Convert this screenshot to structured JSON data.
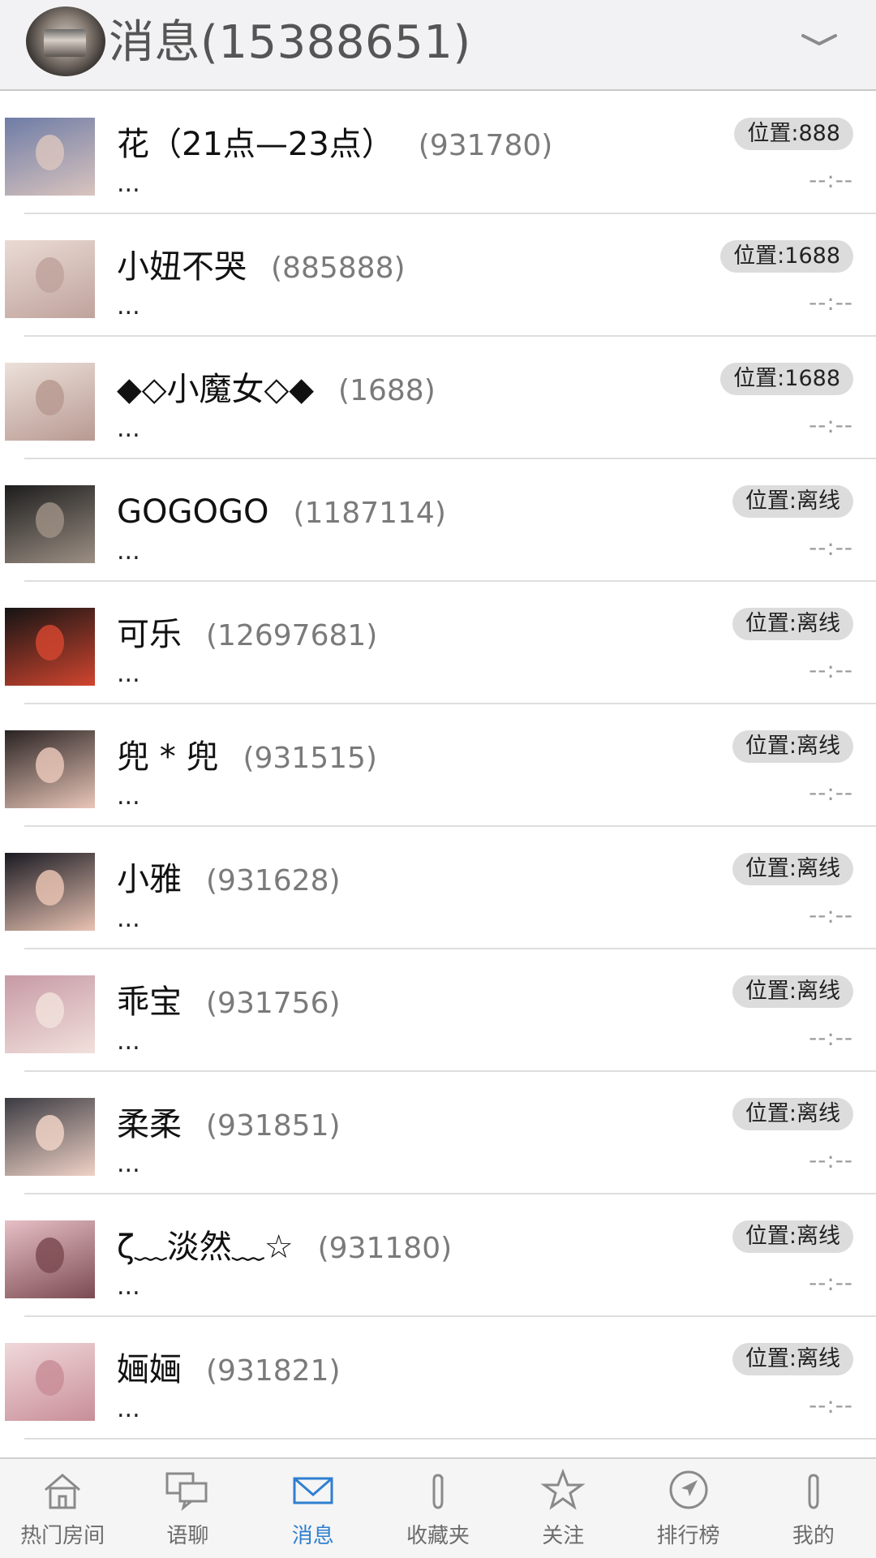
{
  "header": {
    "title": "消息(15388651)",
    "avatar_icon": "user-avatar",
    "chevron_icon": "chevron-down-icon"
  },
  "conversations": [
    {
      "name": "花（21点—23点）",
      "uid": "(931780)",
      "badge": "位置:888",
      "preview": "...",
      "time": "--:--",
      "avatar_colors": [
        "#6e7ca6",
        "#d9c4be"
      ]
    },
    {
      "name": "小妞不哭",
      "uid": "(885888)",
      "badge": "位置:1688",
      "preview": "...",
      "time": "--:--",
      "avatar_colors": [
        "#eadad4",
        "#bfa39c"
      ]
    },
    {
      "name": "◆◇小魔女◇◆",
      "uid": "(1688)",
      "badge": "位置:1688",
      "preview": "...",
      "time": "--:--",
      "avatar_colors": [
        "#ece0da",
        "#b89a92"
      ]
    },
    {
      "name": "GOGOGO",
      "uid": "(1187114)",
      "badge": "位置:离线",
      "preview": "...",
      "time": "--:--",
      "avatar_colors": [
        "#1d1d1d",
        "#9c8f84"
      ]
    },
    {
      "name": "可乐",
      "uid": "(12697681)",
      "badge": "位置:离线",
      "preview": "...",
      "time": "--:--",
      "avatar_colors": [
        "#141414",
        "#d1452f"
      ]
    },
    {
      "name": "兜 * 兜",
      "uid": "(931515)",
      "badge": "位置:离线",
      "preview": "...",
      "time": "--:--",
      "avatar_colors": [
        "#2a2323",
        "#e9c6b8"
      ]
    },
    {
      "name": "小雅",
      "uid": "(931628)",
      "badge": "位置:离线",
      "preview": "...",
      "time": "--:--",
      "avatar_colors": [
        "#1a1a22",
        "#e8c2b2"
      ]
    },
    {
      "name": "乖宝",
      "uid": "(931756)",
      "badge": "位置:离线",
      "preview": "...",
      "time": "--:--",
      "avatar_colors": [
        "#c79aa6",
        "#f1e0db"
      ]
    },
    {
      "name": "柔柔",
      "uid": "(931851)",
      "badge": "位置:离线",
      "preview": "...",
      "time": "--:--",
      "avatar_colors": [
        "#3b3b42",
        "#f0d2c6"
      ]
    },
    {
      "name": "ζ﹏淡然﹏☆",
      "uid": "(931180)",
      "badge": "位置:离线",
      "preview": "...",
      "time": "--:--",
      "avatar_colors": [
        "#e7bfc6",
        "#7c4b52"
      ]
    },
    {
      "name": "婳婳",
      "uid": "(931821)",
      "badge": "位置:离线",
      "preview": "...",
      "time": "--:--",
      "avatar_colors": [
        "#efd8da",
        "#c98e98"
      ]
    }
  ],
  "tabbar": {
    "tabs": [
      {
        "label": "热门房间",
        "icon": "home-icon",
        "active": false
      },
      {
        "label": "语聊",
        "icon": "chat-bubbles-icon",
        "active": false
      },
      {
        "label": "消息",
        "icon": "mail-icon",
        "active": true
      },
      {
        "label": "收藏夹",
        "icon": "paperclip-icon",
        "active": false
      },
      {
        "label": "关注",
        "icon": "star-icon",
        "active": false
      },
      {
        "label": "排行榜",
        "icon": "navigation-icon",
        "active": false
      },
      {
        "label": "我的",
        "icon": "paperclip-icon",
        "active": false
      }
    ],
    "active_color": "#2f7fd0",
    "inactive_color": "#8a8a8a"
  }
}
